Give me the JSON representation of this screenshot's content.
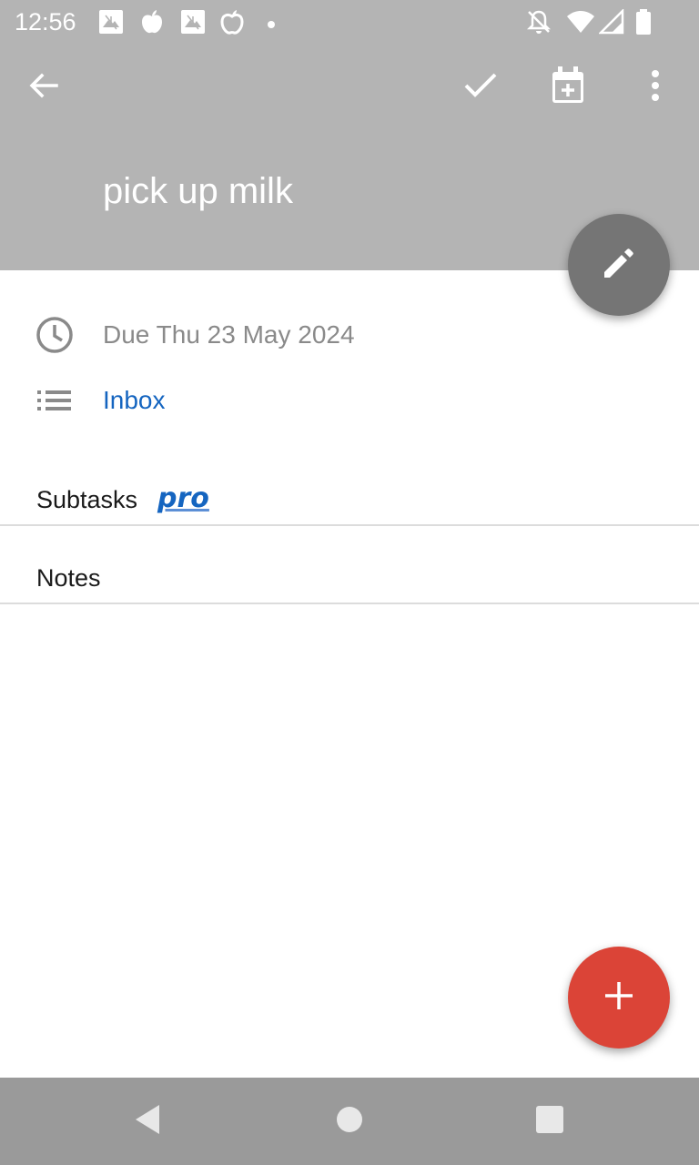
{
  "status_bar": {
    "time": "12:56",
    "notification_icons": [
      "photo-icon",
      "apple-icon",
      "photo-icon",
      "apple-outline-icon",
      "dot-icon"
    ],
    "system_icons": [
      "notifications-off-icon",
      "wifi-icon",
      "cell-signal-icon",
      "battery-icon"
    ]
  },
  "app_bar": {
    "title": "pick up milk",
    "background_color": "#b4b4b4",
    "actions": [
      "back-arrow-icon",
      "checkmark-icon",
      "calendar-add-icon",
      "more-vert-icon"
    ]
  },
  "details": {
    "due": "Due Thu 23 May 2024",
    "list": "Inbox",
    "due_color": "#8a8a8a",
    "list_color": "#1565c0"
  },
  "sections": {
    "subtasks_label": "Subtasks",
    "pro_label": "pro",
    "notes_label": "Notes"
  },
  "colors": {
    "edit_fab": "#757575",
    "add_fab": "#db4437",
    "nav_bar": "#9a9a9a"
  }
}
